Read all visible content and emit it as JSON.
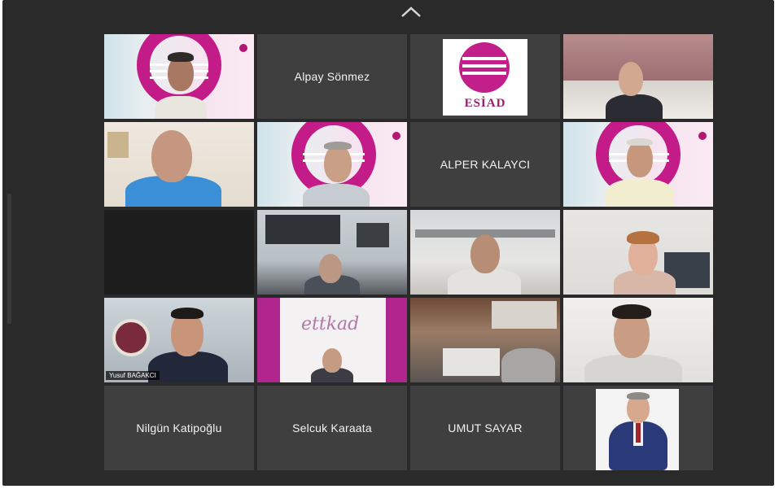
{
  "meeting": {
    "participants": [
      {
        "id": "p1",
        "kind": "video"
      },
      {
        "id": "p2",
        "kind": "name",
        "name": "Alpay Sönmez"
      },
      {
        "id": "p3",
        "kind": "logo",
        "logo_text": "ESİAD"
      },
      {
        "id": "p4",
        "kind": "video"
      },
      {
        "id": "p5",
        "kind": "video"
      },
      {
        "id": "p6",
        "kind": "video"
      },
      {
        "id": "p7",
        "kind": "name",
        "name": "ALPER KALAYCI"
      },
      {
        "id": "p8",
        "kind": "video"
      },
      {
        "id": "p9",
        "kind": "blank"
      },
      {
        "id": "p10",
        "kind": "video"
      },
      {
        "id": "p11",
        "kind": "video"
      },
      {
        "id": "p12",
        "kind": "video"
      },
      {
        "id": "p13",
        "kind": "video",
        "tag": "Yusuf BAĞAKCI",
        "active": true
      },
      {
        "id": "p14",
        "kind": "video",
        "logo_text": "ettkad"
      },
      {
        "id": "p15",
        "kind": "video"
      },
      {
        "id": "p16",
        "kind": "video"
      },
      {
        "id": "p17",
        "kind": "name",
        "name": "Nilgün Katipoğlu"
      },
      {
        "id": "p18",
        "kind": "name",
        "name": "Selcuk Karaata"
      },
      {
        "id": "p19",
        "kind": "name",
        "name": "UMUT SAYAR"
      },
      {
        "id": "p20",
        "kind": "video"
      }
    ]
  },
  "icons": {
    "collapse": "chevron-up-icon"
  },
  "colors": {
    "background": "#2a2a2a",
    "tile": "#3f3f3f",
    "brand_pink": "#c31b87",
    "active_speaker": "#d8c45a"
  }
}
